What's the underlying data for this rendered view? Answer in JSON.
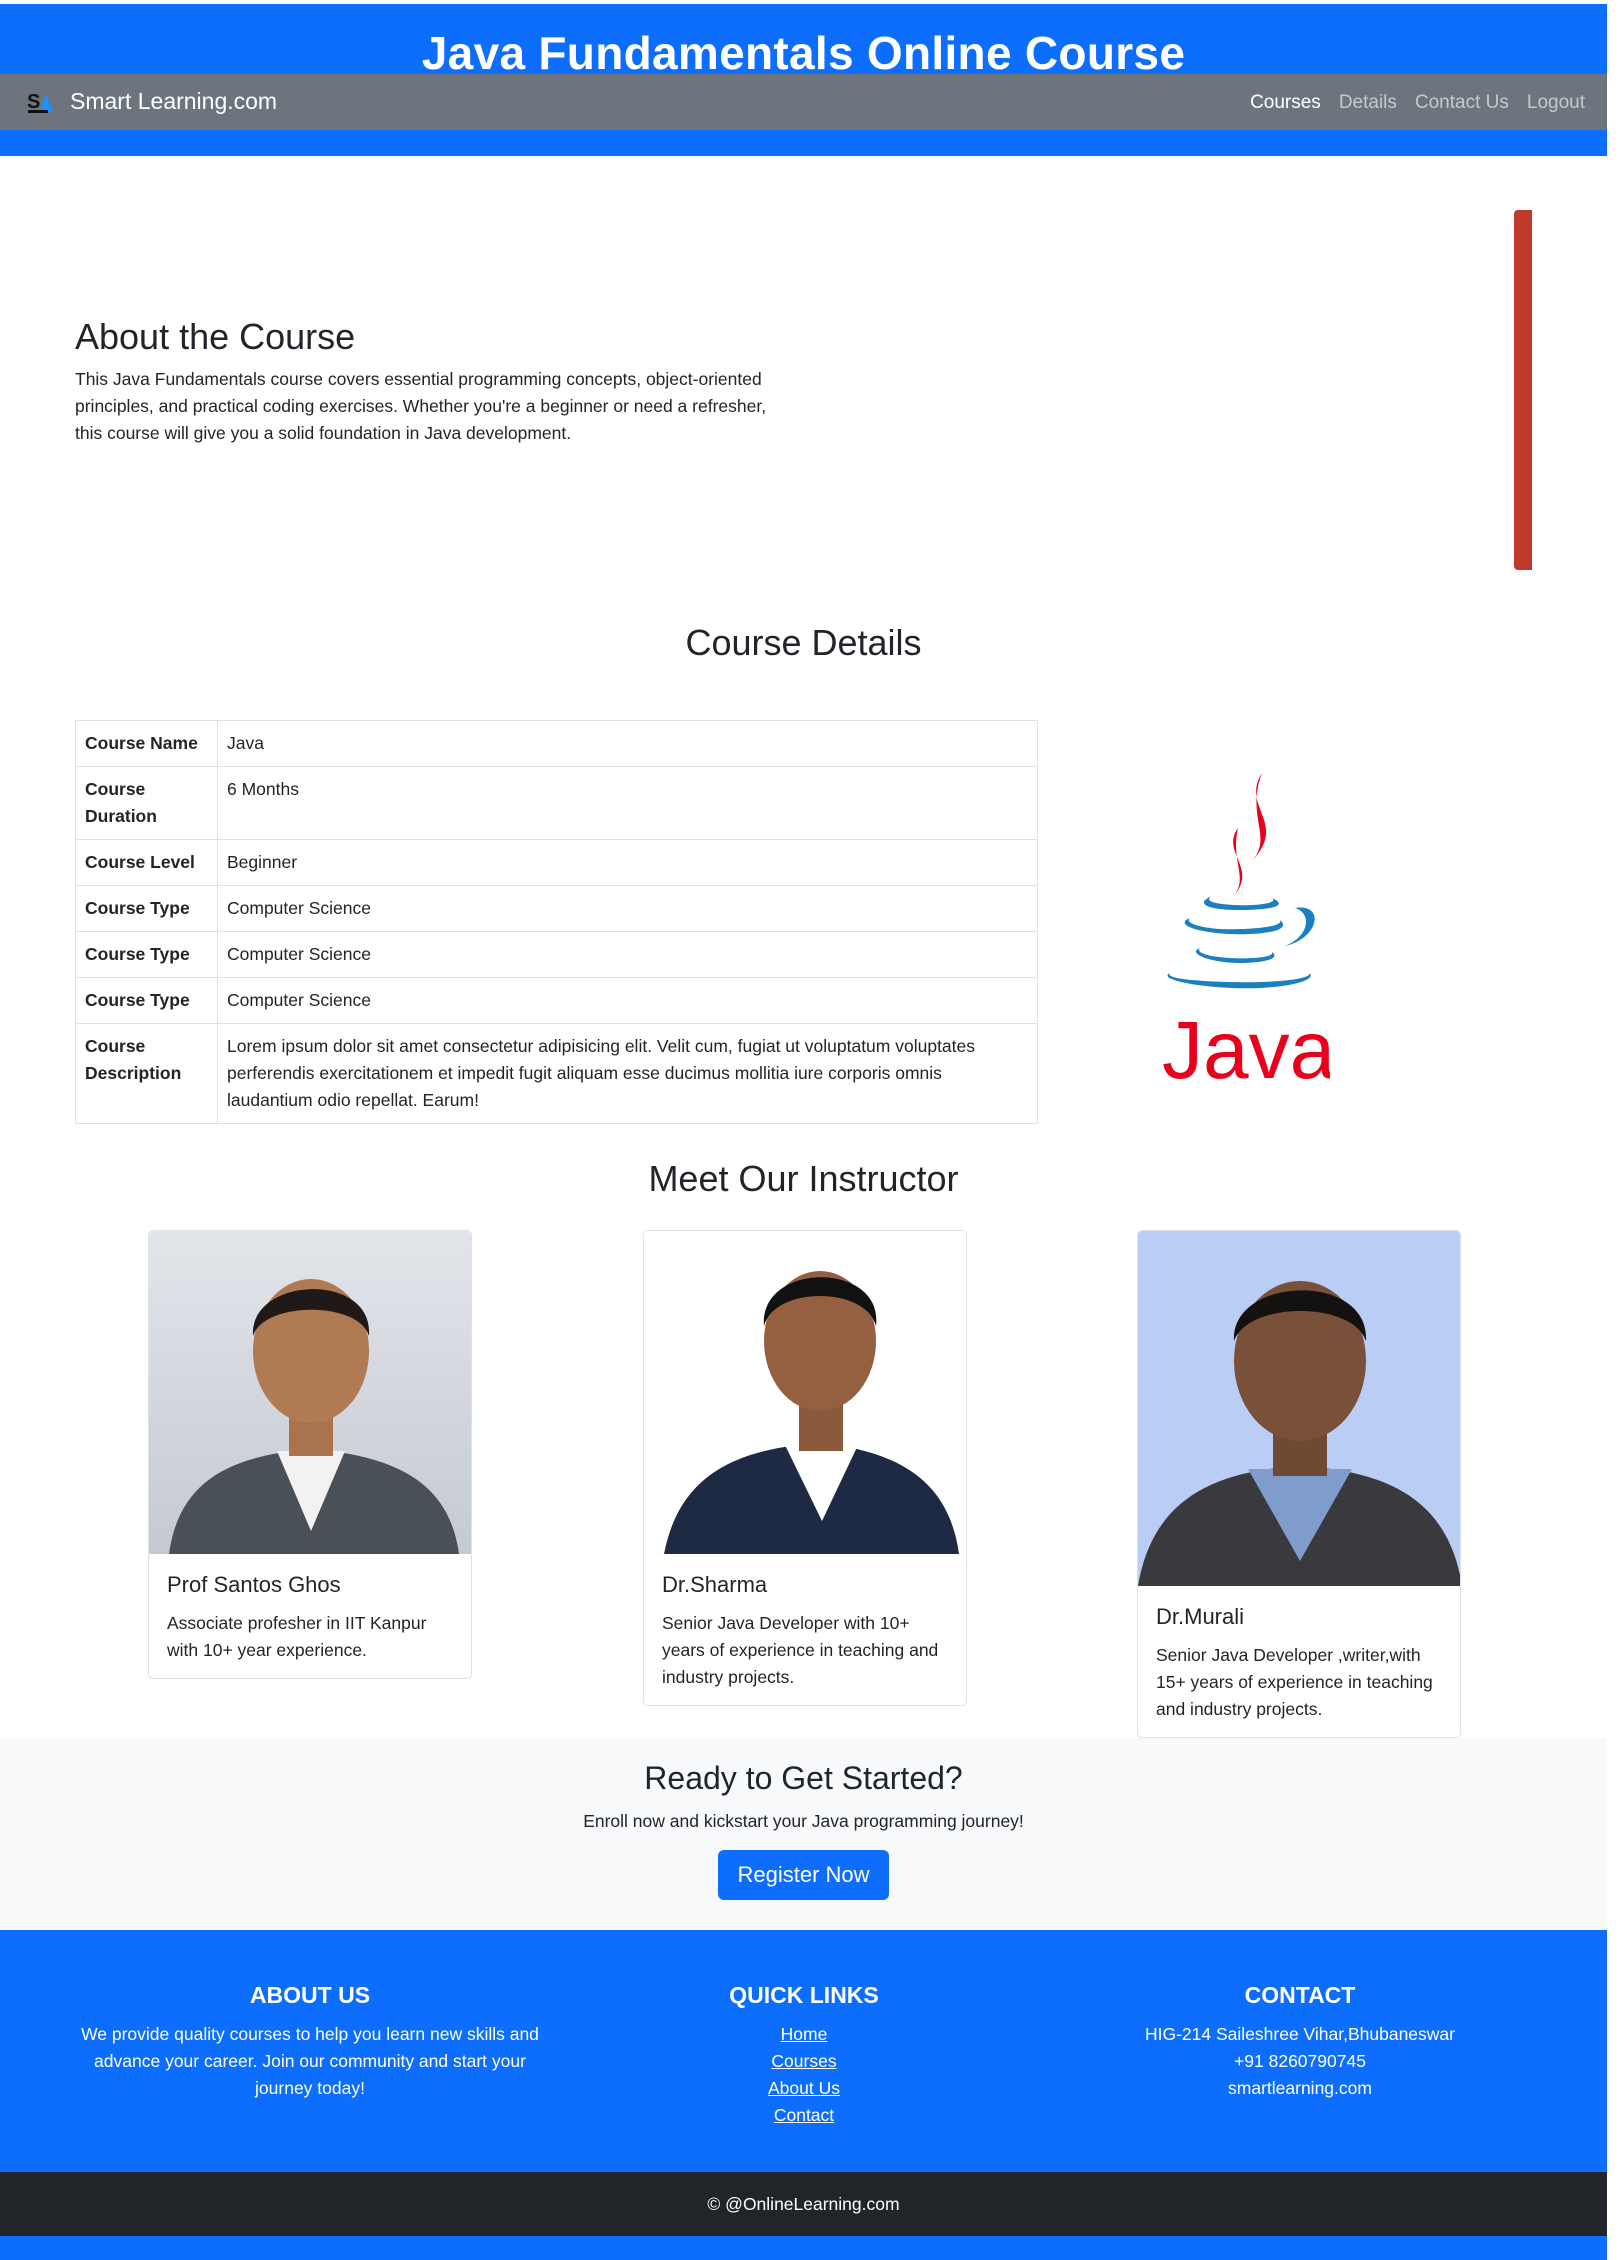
{
  "header": {
    "site_title": "Java Fundamentals Online Course",
    "brand": "Smart Learning.com",
    "nav": [
      {
        "label": "Courses",
        "active": true
      },
      {
        "label": "Details",
        "active": false
      },
      {
        "label": "Contact Us",
        "active": false
      },
      {
        "label": "Logout",
        "active": false
      }
    ]
  },
  "about": {
    "title": "About the Course",
    "text": "This Java Fundamentals course covers essential programming concepts, object-oriented principles, and practical coding exercises. Whether you're a beginner or need a refresher, this course will give you a solid foundation in Java development."
  },
  "details": {
    "title": "Course Details",
    "rows": [
      {
        "key": "Course Name",
        "value": "Java"
      },
      {
        "key": "Course Duration",
        "value": "6 Months"
      },
      {
        "key": "Course Level",
        "value": "Beginner"
      },
      {
        "key": "Course Type",
        "value": "Computer Science"
      },
      {
        "key": "Course Type",
        "value": "Computer Science"
      },
      {
        "key": "Course Type",
        "value": "Computer Science"
      },
      {
        "key": "Course Description",
        "value": "Lorem ipsum dolor sit amet consectetur adipisicing elit. Velit cum, fugiat ut voluptatum voluptates perferendis exercitationem et impedit fugit aliquam esse ducimus mollitia iure corporis omnis laudantium odio repellat. Earum!"
      }
    ],
    "logo_text": "Java"
  },
  "instructors": {
    "title": "Meet Our Instructor",
    "items": [
      {
        "name": "Prof Santos Ghos",
        "text": "Associate profesher in IIT Kanpur with 10+ year experience."
      },
      {
        "name": "Dr.Sharma",
        "text": "Senior Java Developer with 10+ years of experience in teaching and industry projects."
      },
      {
        "name": "Dr.Murali",
        "text": "Senior Java Developer ,writer,with 15+ years of experience in teaching and industry projects."
      }
    ]
  },
  "cta": {
    "title": "Ready to Get Started?",
    "text": "Enroll now and kickstart your Java programming journey!",
    "button": "Register Now"
  },
  "footer": {
    "about_title": "ABOUT US",
    "about_text": "We provide quality courses to help you learn new skills and advance your career. Join our community and start your journey today!",
    "links_title": "QUICK LINKS",
    "links": [
      "Home",
      "Courses",
      "About Us",
      "Contact"
    ],
    "contact_title": "CONTACT",
    "address": "HIG-214 Saileshree Vihar,Bhubaneswar",
    "phone": "+91 8260790745",
    "website": "smartlearning.com",
    "copyright": "© @OnlineLearning.com"
  },
  "colors": {
    "primary": "#0d6efd",
    "navbar": "#6c757d",
    "dark": "#212529",
    "light": "#f8f9fa",
    "accent_red": "#c0392b"
  }
}
